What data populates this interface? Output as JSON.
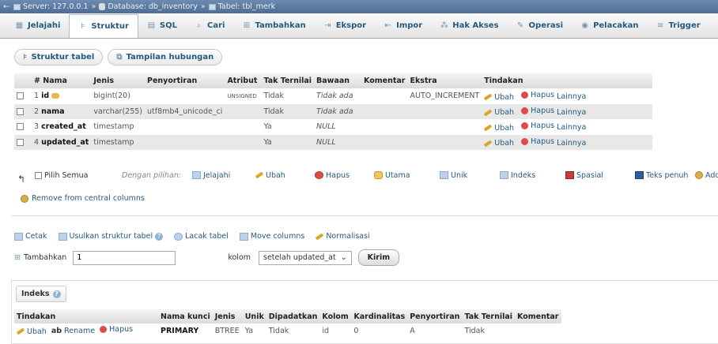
{
  "breadcrumb": {
    "server": "Server: 127.0.0.1",
    "database": "Database: db_inventory",
    "table": "Tabel: tbl_merk"
  },
  "tabs": [
    {
      "label": "Jelajahi",
      "icon": "table-icon"
    },
    {
      "label": "Struktur",
      "icon": "structure-icon",
      "active": true
    },
    {
      "label": "SQL",
      "icon": "sql-icon"
    },
    {
      "label": "Cari",
      "icon": "search-icon"
    },
    {
      "label": "Tambahkan",
      "icon": "insert-icon"
    },
    {
      "label": "Ekspor",
      "icon": "export-icon"
    },
    {
      "label": "Impor",
      "icon": "import-icon"
    },
    {
      "label": "Hak Akses",
      "icon": "privileges-icon"
    },
    {
      "label": "Operasi",
      "icon": "wrench-icon"
    },
    {
      "label": "Pelacakan",
      "icon": "eye-icon"
    },
    {
      "label": "Trigger",
      "icon": "trigger-icon"
    }
  ],
  "subtabs": {
    "structure": "Struktur tabel",
    "relation": "Tampilan hubungan"
  },
  "structure": {
    "headers": [
      "#",
      "Nama",
      "Jenis",
      "Penyortiran",
      "Atribut",
      "Tak Ternilai",
      "Bawaan",
      "Komentar",
      "Ekstra",
      "Tindakan"
    ],
    "rows": [
      {
        "num": "1",
        "name": "id",
        "type": "bigint(20)",
        "collation": "",
        "attr": "UNSIGNED",
        "null": "Tidak",
        "default": "Tidak ada",
        "comment": "",
        "extra": "AUTO_INCREMENT"
      },
      {
        "num": "2",
        "name": "nama",
        "type": "varchar(255)",
        "collation": "utf8mb4_unicode_ci",
        "attr": "",
        "null": "Tidak",
        "default": "Tidak ada",
        "comment": "",
        "extra": ""
      },
      {
        "num": "3",
        "name": "created_at",
        "type": "timestamp",
        "collation": "",
        "attr": "",
        "null": "Ya",
        "default": "NULL",
        "comment": "",
        "extra": ""
      },
      {
        "num": "4",
        "name": "updated_at",
        "type": "timestamp",
        "collation": "",
        "attr": "",
        "null": "Ya",
        "default": "NULL",
        "comment": "",
        "extra": ""
      }
    ],
    "actions": {
      "edit": "Ubah",
      "drop": "Hapus",
      "more": "Lainnya"
    }
  },
  "bulk": {
    "check_all": "Pilih Semua",
    "with_selected": "Dengan pilihan:",
    "browse": "Jelajahi",
    "change": "Ubah",
    "drop": "Hapus",
    "primary": "Utama",
    "unique": "Unik",
    "index": "Indeks",
    "spatial": "Spasial",
    "fulltext": "Teks penuh",
    "add": "Add",
    "remove_central": "Remove from central columns"
  },
  "links": {
    "print": "Cetak",
    "propose": "Usulkan struktur tabel",
    "track": "Lacak tabel",
    "move": "Move columns",
    "normalize": "Normalisasi"
  },
  "add_columns": {
    "label": "Tambahkan",
    "value": "1",
    "unit": "kolom",
    "position": "setelah updated_at",
    "submit": "Kirim"
  },
  "indexes": {
    "title": "Indeks",
    "headers": [
      "Tindakan",
      "Nama kunci",
      "Jenis",
      "Unik",
      "Dipadatkan",
      "Kolom",
      "Kardinalitas",
      "Penyortiran",
      "Tak Ternilai",
      "Komentar"
    ],
    "row": {
      "edit": "Ubah",
      "rename": "Rename",
      "drop": "Hapus",
      "key_name": "PRIMARY",
      "type": "BTREE",
      "unique": "Ya",
      "packed": "Tidak",
      "column": "id",
      "cardinality": "0",
      "collation": "A",
      "null": "Tidak",
      "comment": ""
    }
  }
}
